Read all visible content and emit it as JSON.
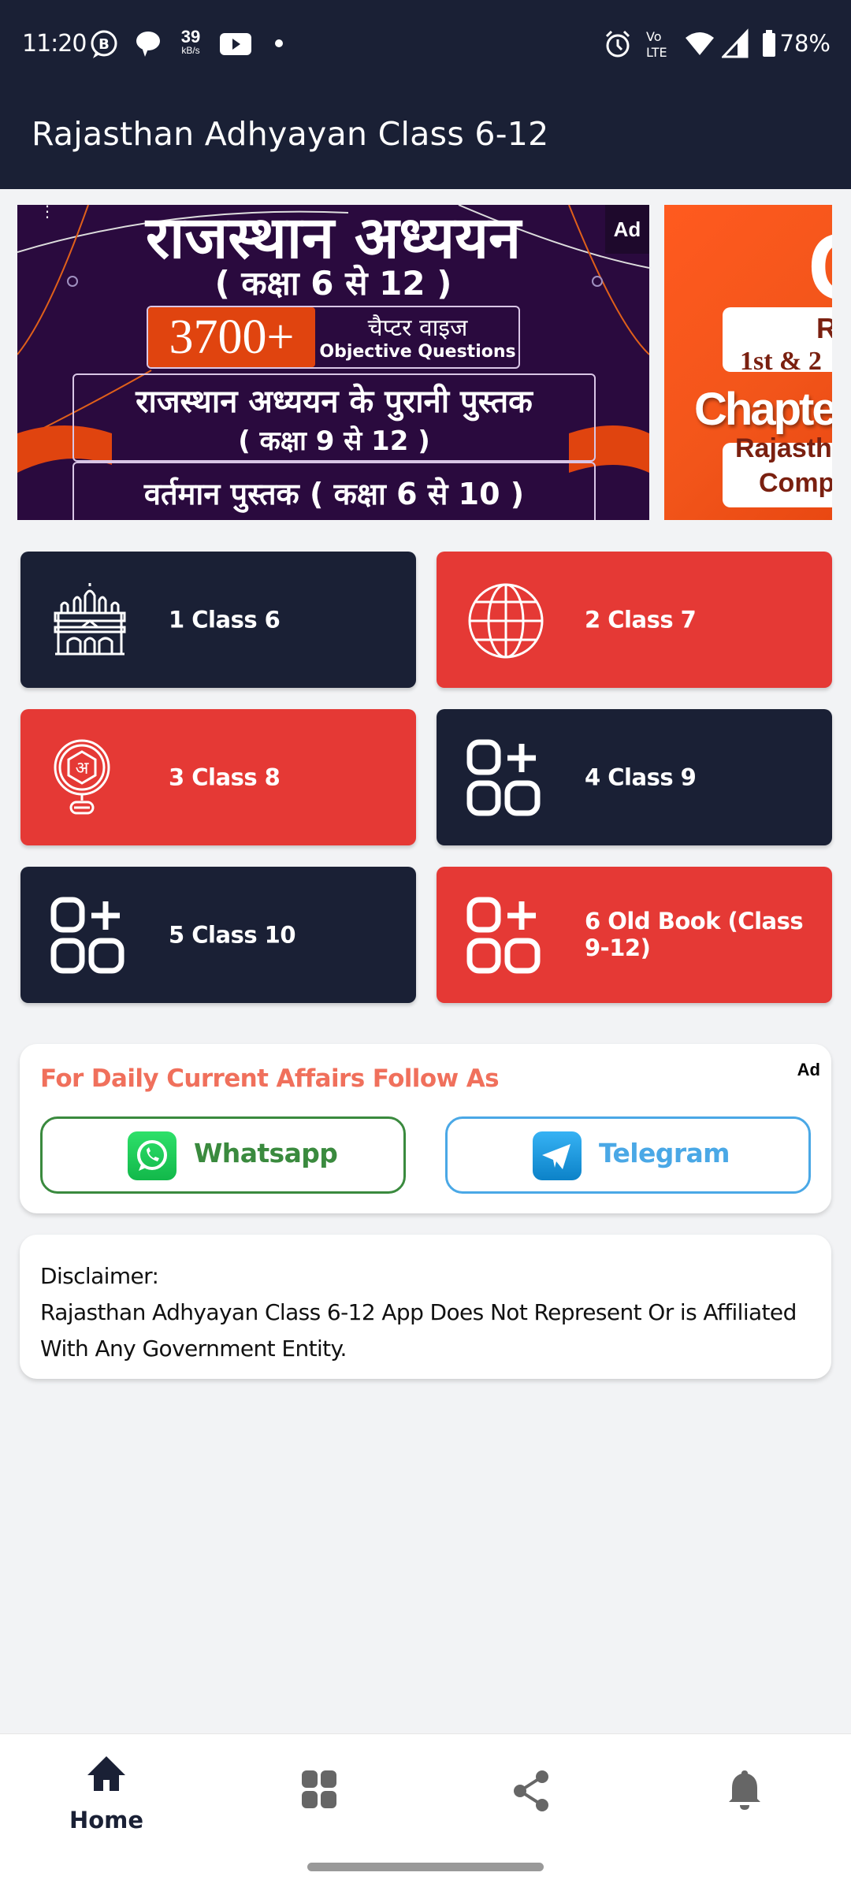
{
  "status_bar": {
    "time": "11:20",
    "net_speed_value": "39",
    "net_speed_unit": "kB/s",
    "battery_percent": "78%",
    "left_icons": [
      "business-chat-icon",
      "chat-bubble-icon",
      "youtube-icon",
      "dot-icon"
    ],
    "right_icons": [
      "alarm-icon",
      "volte-icon",
      "wifi-icon",
      "signal-icon",
      "battery-icon"
    ]
  },
  "app_bar": {
    "title": "Rajasthan Adhyayan Class 6-12"
  },
  "carousel": {
    "banners": [
      {
        "title": "राजस्थान अध्ययन",
        "subtitle": "( कक्षा 6 से 12 )",
        "count": "3700+",
        "count_hindi": "चैप्टर वाइज",
        "count_english": "Objective Questions",
        "box1_line1": "राजस्थान अध्ययन के पुरानी पुस्तक",
        "box1_line2": "( कक्षा 9 से 12 )",
        "box2": "वर्तमान पुस्तक ( कक्षा 6 से 10 )",
        "ad_label": "Ad"
      },
      {
        "big": "C",
        "line1": "R",
        "line2": "1st & 2",
        "line3": "Chapter",
        "line4": "Rajasth",
        "line5": "Comp"
      }
    ]
  },
  "classes": [
    {
      "label": "1 Class 6",
      "icon": "palace-icon",
      "theme": "dark"
    },
    {
      "label": "2 Class 7",
      "icon": "globe-icon",
      "theme": "red"
    },
    {
      "label": "3 Class 8",
      "icon": "hindi-letter-icon",
      "theme": "red"
    },
    {
      "label": "4 Class 9",
      "icon": "apps-add-icon",
      "theme": "dark"
    },
    {
      "label": "5 Class 10",
      "icon": "apps-add-icon",
      "theme": "dark"
    },
    {
      "label": "6 Old Book (Class 9-12)",
      "icon": "apps-add-icon",
      "theme": "red"
    }
  ],
  "follow": {
    "title": "For Daily Current Affairs Follow As",
    "ad_label": "Ad",
    "whatsapp_label": "Whatsapp",
    "telegram_label": "Telegram"
  },
  "disclaimer": {
    "heading": "Disclaimer:",
    "text": "Rajasthan Adhyayan Class 6-12 App Does Not Represent Or is Affiliated With Any Government Entity."
  },
  "bottom_nav": {
    "items": [
      {
        "label": "Home",
        "icon": "home-icon",
        "active": true
      },
      {
        "label": "",
        "icon": "grid-icon",
        "active": false
      },
      {
        "label": "",
        "icon": "share-icon",
        "active": false
      },
      {
        "label": "",
        "icon": "bell-icon",
        "active": false
      }
    ]
  },
  "colors": {
    "primary_dark": "#1a2035",
    "accent_red": "#e53935",
    "follow_title": "#f0705c",
    "whatsapp_green": "#3a8a3e",
    "telegram_blue": "#4aa8e6",
    "background": "#f2f3f5"
  }
}
